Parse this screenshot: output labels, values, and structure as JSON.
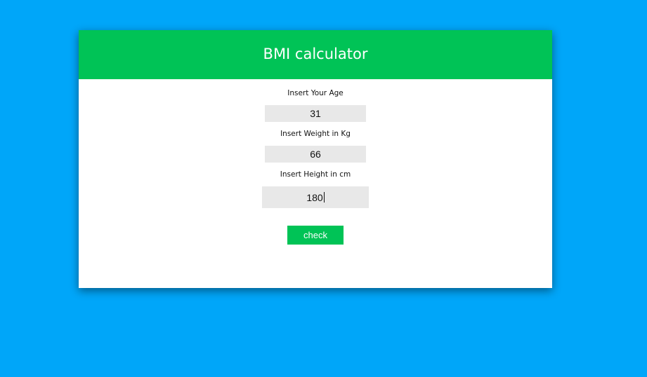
{
  "header": {
    "title": "BMI calculator"
  },
  "form": {
    "age": {
      "label": "Insert Your Age",
      "value": "31"
    },
    "weight": {
      "label": "Insert Weight in Kg",
      "value": "66"
    },
    "height": {
      "label": "Insert Height in cm",
      "value": "180"
    },
    "check_label": "check"
  },
  "colors": {
    "page_background": "#00a6f9",
    "accent_green": "#00c356",
    "input_background": "#e8e8e8"
  }
}
